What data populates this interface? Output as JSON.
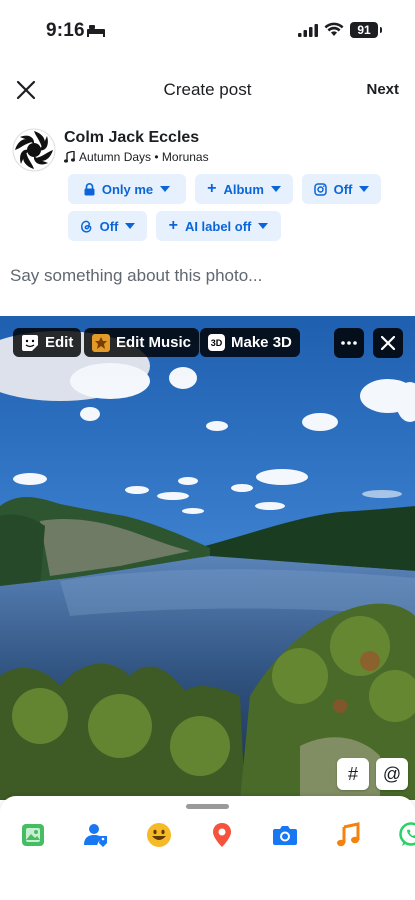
{
  "status_bar": {
    "time": "9:16",
    "battery": "91"
  },
  "header": {
    "title": "Create post",
    "next_label": "Next"
  },
  "author": {
    "name": "Colm Jack Eccles",
    "music": "Autumn Days • Morunas"
  },
  "chips": {
    "privacy": "Only me",
    "album": "Album",
    "instagram": "Off",
    "threads": "Off",
    "ai_label": "AI label off"
  },
  "composer": {
    "placeholder": "Say something about this photo..."
  },
  "photo_tools": {
    "edit": "Edit",
    "edit_music": "Edit Music",
    "make_3d": "Make 3D",
    "make_3d_badge": "3D",
    "hashtag": "#",
    "mention": "@"
  },
  "bottom_tools": [
    "photo-icon",
    "tag-people-icon",
    "feeling-icon",
    "check-in-icon",
    "camera-icon",
    "music-icon",
    "whatsapp-icon"
  ],
  "colors": {
    "accent": "#0a66d8",
    "chip_bg": "#e7f0fd",
    "photo": "#45bd62",
    "tag": "#1877f2",
    "feeling": "#f7b928",
    "checkin": "#f5533d",
    "music": "#f5820d",
    "whatsapp": "#25d366"
  }
}
